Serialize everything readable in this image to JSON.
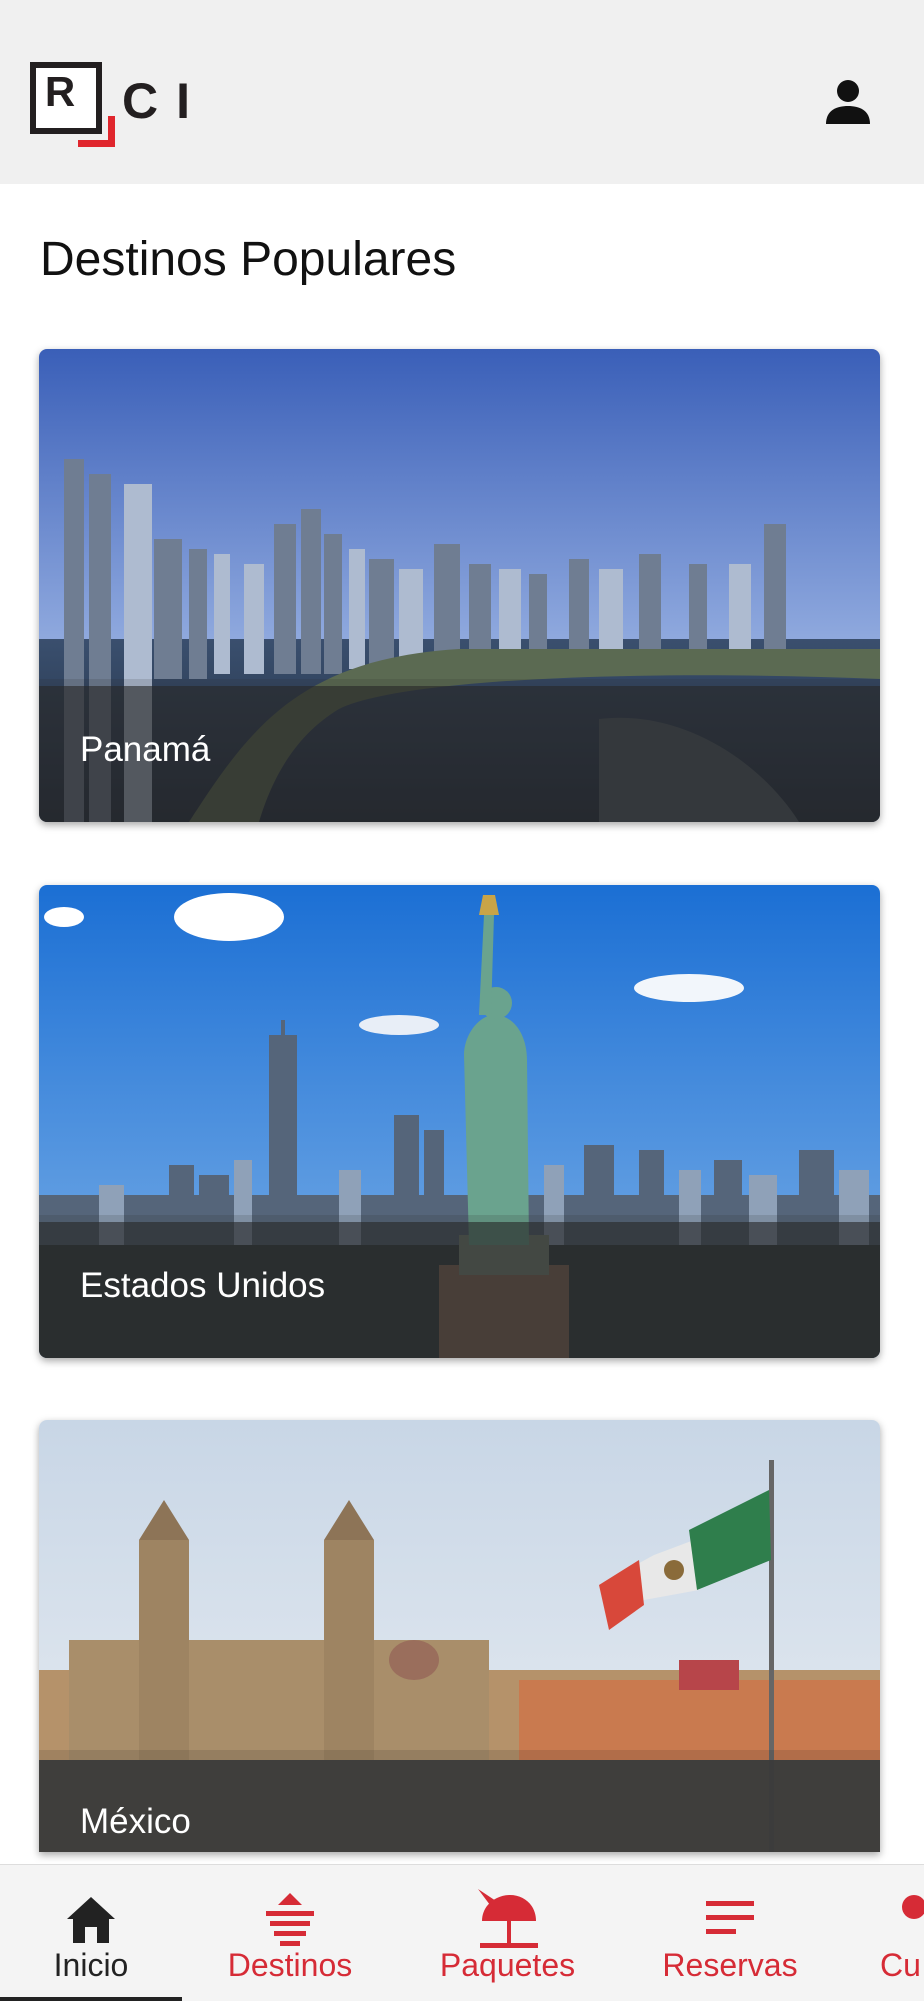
{
  "header": {
    "logo_r": "R",
    "logo_ci": "CI",
    "profile_icon": "person-icon"
  },
  "main": {
    "title": "Destinos Populares",
    "destinations": [
      {
        "name": "Panamá"
      },
      {
        "name": "Estados Unidos"
      },
      {
        "name": "México"
      }
    ]
  },
  "bottom_nav": {
    "items": [
      {
        "label": "Inicio",
        "icon": "home-icon",
        "active": true
      },
      {
        "label": "Destinos",
        "icon": "destinations-icon",
        "active": false
      },
      {
        "label": "Paquetes",
        "icon": "beach-umbrella-icon",
        "active": false
      },
      {
        "label": "Reservas",
        "icon": "list-icon",
        "active": false
      },
      {
        "label": "Cu",
        "icon": "user-icon",
        "active": false
      }
    ]
  },
  "colors": {
    "brand_red": "#d62b36",
    "header_bg": "#f0f0f0",
    "nav_bg": "#f4f4f4"
  }
}
